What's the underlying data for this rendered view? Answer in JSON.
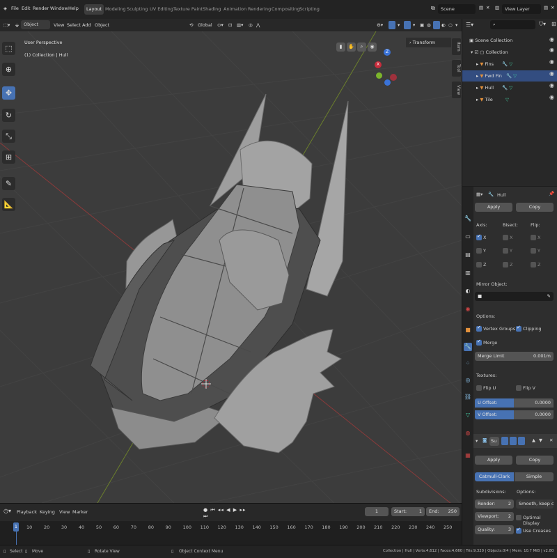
{
  "topbar": {
    "menus": [
      "File",
      "Edit",
      "Render",
      "Window",
      "Help"
    ],
    "workspaces": [
      "Layout",
      "Modeling",
      "Sculpting",
      "UV Editing",
      "Texture Paint",
      "Shading",
      "Animation",
      "Rendering",
      "Compositing",
      "Scripting"
    ],
    "active_workspace": "Layout",
    "scene": "Scene",
    "view_layer": "View Layer"
  },
  "viewport_header": {
    "mode": "Object Mode",
    "menus": [
      "View",
      "Select",
      "Add",
      "Object"
    ],
    "orientation": "Global"
  },
  "viewport": {
    "view_name": "User Perspective",
    "collection_info": "(1) Collection | Hull",
    "transform_panel": "Transform",
    "side_tabs": [
      "Item",
      "Tool",
      "View"
    ],
    "gizmo": {
      "x": "X",
      "y": "Y",
      "z": "Z"
    }
  },
  "outliner": {
    "search_placeholder": "",
    "items": [
      {
        "label": "Scene Collection"
      },
      {
        "label": "Collection"
      },
      {
        "label": "Fins"
      },
      {
        "label": "Fwd Fin"
      },
      {
        "label": "Hull"
      },
      {
        "label": "Tile"
      }
    ]
  },
  "properties": {
    "object_name": "Hull",
    "mirror": {
      "apply": "Apply",
      "copy": "Copy",
      "axis_header": "Axis:",
      "bisect_header": "Bisect:",
      "flip_header": "Flip:",
      "axes": [
        "X",
        "Y",
        "Z"
      ],
      "mirror_object": "Mirror Object:",
      "options": "Options:",
      "vertex_groups": "Vertex Groups",
      "clipping": "Clipping",
      "merge": "Merge",
      "merge_limit_label": "Merge Limit",
      "merge_limit_value": "0.001m",
      "textures": "Textures:",
      "flip_u": "Flip U",
      "flip_v": "Flip V",
      "u_offset_label": "U Offset:",
      "u_offset_value": "0.0000",
      "v_offset_label": "V Offset:",
      "v_offset_value": "0.0000"
    },
    "subsurf": {
      "name": "Su",
      "apply": "Apply",
      "copy": "Copy",
      "catmull": "Catmull-Clark",
      "simple": "Simple",
      "subdivisions": "Subdivisions:",
      "options": "Options:",
      "render_label": "Render:",
      "render_value": "2",
      "viewport_label": "Viewport:",
      "viewport_value": "2",
      "quality_label": "Quality:",
      "quality_value": "3",
      "smooth_option": "Smooth, keep co...",
      "optimal_display": "Optimal Display",
      "use_creases": "Use Creases"
    }
  },
  "timeline": {
    "menus": [
      "Playback",
      "Keying",
      "View",
      "Marker"
    ],
    "current_frame": "1",
    "start_label": "Start:",
    "start": "1",
    "end_label": "End:",
    "end": "250",
    "ticks": [
      "1",
      "10",
      "20",
      "30",
      "40",
      "50",
      "60",
      "70",
      "80",
      "90",
      "100",
      "110",
      "120",
      "130",
      "140",
      "150",
      "160",
      "170",
      "180",
      "190",
      "200",
      "210",
      "220",
      "230",
      "240",
      "250"
    ]
  },
  "statusbar": {
    "select": "Select",
    "move": "Move",
    "rotate": "Rotate View",
    "context": "Object Context Menu",
    "stats": "Collection | Hull | Verts:4,612 | Faces:4,660 | Tris:9,320 | Objects:0/4 | Mem: 10.7 MiB | v2.80.75"
  },
  "colors": {
    "accent": "#4772b3",
    "viewport_bg": "#3c3c3c",
    "panel_bg": "#2e2e2e"
  }
}
